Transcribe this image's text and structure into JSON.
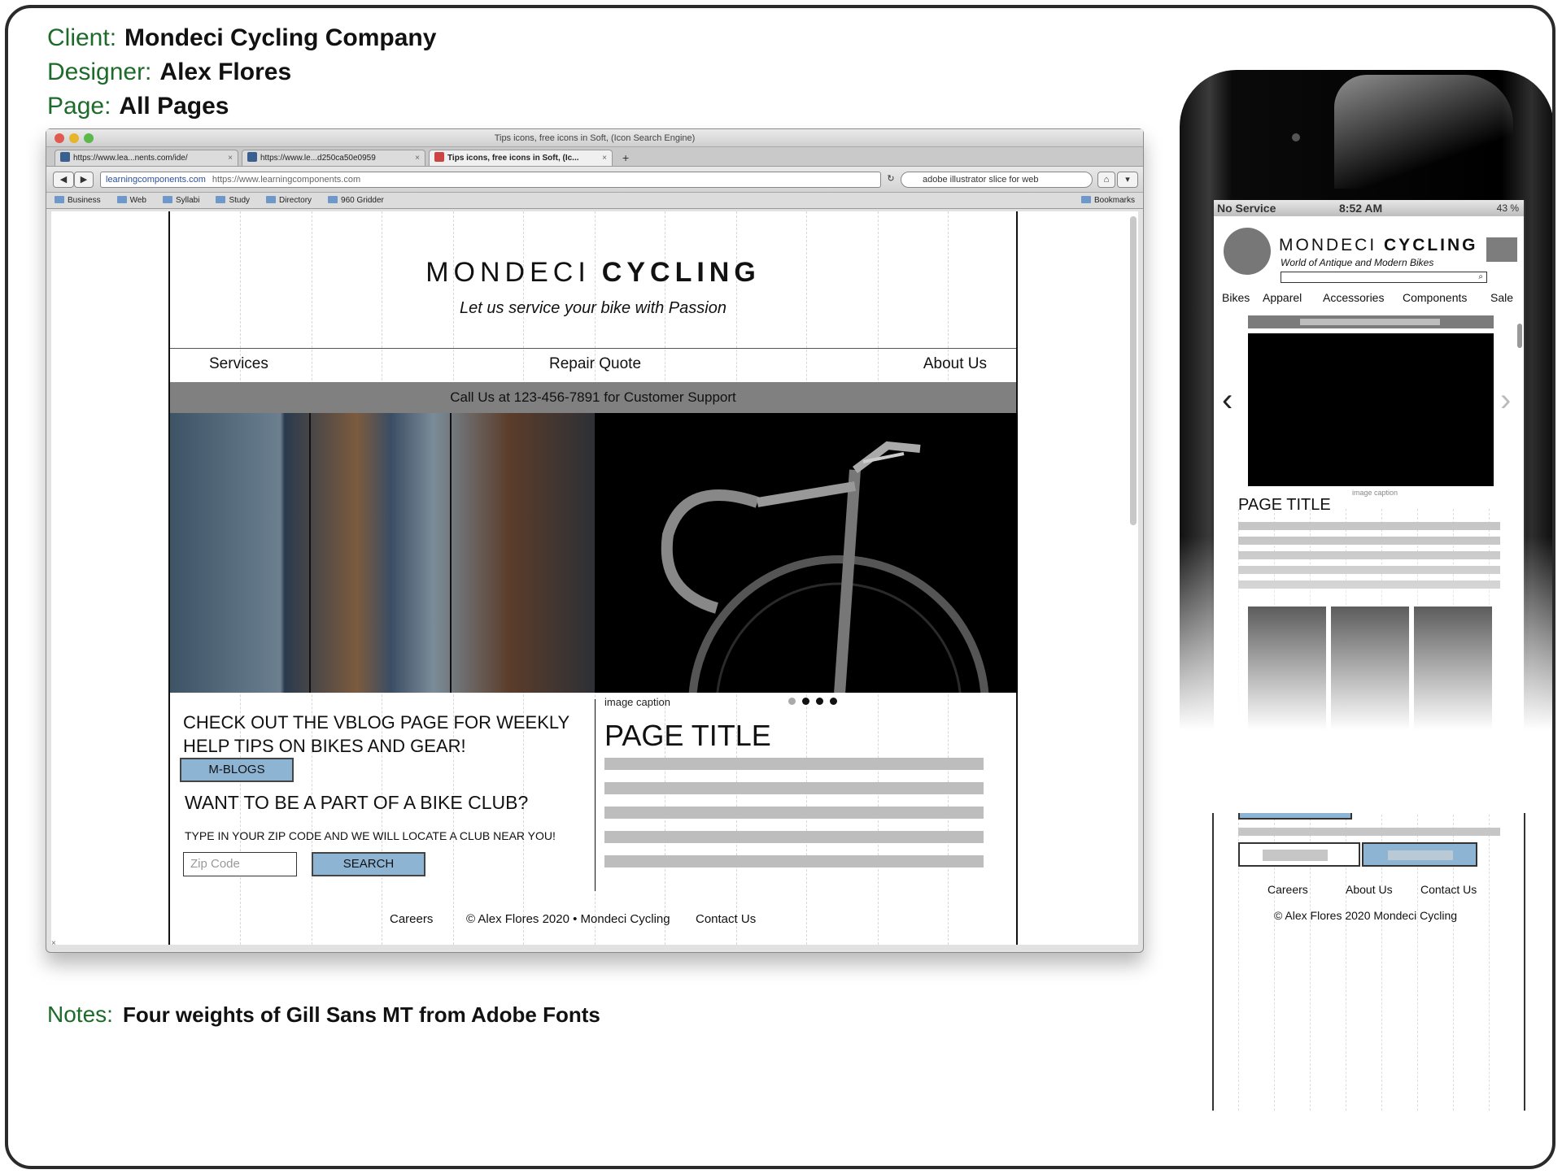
{
  "meta": {
    "client_label": "Client:",
    "client_value": "Mondeci Cycling Company",
    "designer_label": "Designer:",
    "designer_value": "Alex Flores",
    "page_label": "Page:",
    "page_value": "All Pages",
    "notes_label": "Notes:",
    "notes_value": "Four weights of Gill Sans MT from Adobe Fonts"
  },
  "browser": {
    "window_title": "Tips icons, free icons in Soft, (Icon Search Engine)",
    "tabs": [
      {
        "label": "https://www.lea...nents.com/ide/"
      },
      {
        "label": "https://www.le...d250ca50e0959"
      },
      {
        "label": "Tips icons, free icons in Soft, (Ic..."
      }
    ],
    "new_tab": "+",
    "url_host": "learningcomponents.com",
    "url_full": "https://www.learningcomponents.com",
    "search_value": "adobe illustrator slice for web",
    "bookmarks": [
      "Business",
      "Web",
      "Syllabi",
      "Study",
      "Directory",
      "960 Gridder"
    ],
    "bookmarks_menu": "Bookmarks",
    "status_x": "×"
  },
  "site": {
    "logo_light": "MONDECI",
    "logo_bold": "CYCLING",
    "tagline": "Let us service your bike with Passion",
    "nav": [
      "Services",
      "Repair Quote",
      "About Us"
    ],
    "call_bar": "Call Us at 123-456-7891 for Customer Support",
    "image_caption": "image caption",
    "vblog_text": "CHECK OUT THE VBLOG PAGE FOR WEEKLY HELP TIPS ON BIKES AND GEAR!",
    "mblogs_button": "M-BLOGS",
    "club_heading": "WANT TO BE A PART OF A BIKE CLUB?",
    "zip_instruction": "TYPE IN YOUR ZIP CODE AND WE WILL LOCATE A CLUB NEAR YOU!",
    "zip_placeholder": "Zip Code",
    "search_button": "SEARCH",
    "page_title": "PAGE TITLE",
    "footer": {
      "careers": "Careers",
      "copyright": "© Alex Flores 2020 • Mondeci Cycling",
      "contact": "Contact Us"
    }
  },
  "phone": {
    "carrier": "No Service",
    "time": "8:52 AM",
    "battery": "43 %",
    "logo_light": "MONDECI",
    "logo_bold": "CYCLING",
    "tagline": "World of Antique and Modern Bikes",
    "nav": [
      "Bikes",
      "Apparel",
      "Accessories",
      "Components",
      "Sale"
    ],
    "image_caption": "image caption",
    "page_title": "PAGE TITLE",
    "footer": [
      "Careers",
      "About Us",
      "Contact Us"
    ],
    "copyright": "© Alex Flores 2020  Mondeci Cycling"
  },
  "colors": {
    "label_green": "#1d6b2a",
    "button_blue": "#8eb4d4",
    "call_bar_gray": "#808080",
    "placeholder_gray": "#bdbdbd"
  }
}
